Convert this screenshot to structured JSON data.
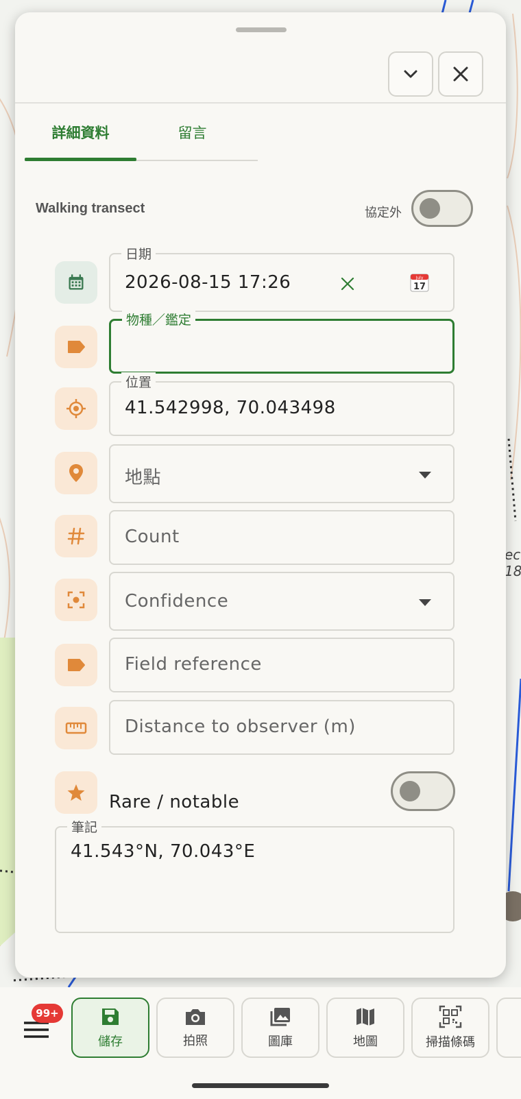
{
  "tabs": {
    "details": "詳細資料",
    "comments": "留言"
  },
  "survey": {
    "name": "Walking transect",
    "off_protocol_label": "協定外",
    "off_protocol_on": false
  },
  "fields": {
    "date": {
      "legend": "日期",
      "value": "2026-08-15 17:26"
    },
    "species": {
      "legend": "物種／鑑定",
      "value": ""
    },
    "position": {
      "legend": "位置",
      "value": "41.542998, 70.043498"
    },
    "site": {
      "placeholder": "地點"
    },
    "count": {
      "placeholder": "Count"
    },
    "confidence": {
      "placeholder": "Confidence"
    },
    "field_reference": {
      "placeholder": "Field reference"
    },
    "distance": {
      "placeholder": "Distance to observer (m)"
    },
    "rare": {
      "label": "Rare / notable",
      "on": false
    },
    "notes": {
      "legend": "筆記",
      "value": "41.543°N, 70.043°E"
    }
  },
  "calendar_icon": {
    "month": "July",
    "day": "17"
  },
  "bottom_nav": {
    "badge": "99+",
    "items": [
      {
        "label": "儲存",
        "icon": "save-icon"
      },
      {
        "label": "拍照",
        "icon": "camera-icon"
      },
      {
        "label": "圖庫",
        "icon": "gallery-icon"
      },
      {
        "label": "地圖",
        "icon": "map-icon"
      },
      {
        "label": "掃描條碼",
        "icon": "qr-scan-icon"
      }
    ]
  },
  "colors": {
    "accent": "#2e7d32",
    "icon_orange": "#e0893a",
    "tile_bg": "#fae8d6",
    "badge": "#e53935"
  }
}
